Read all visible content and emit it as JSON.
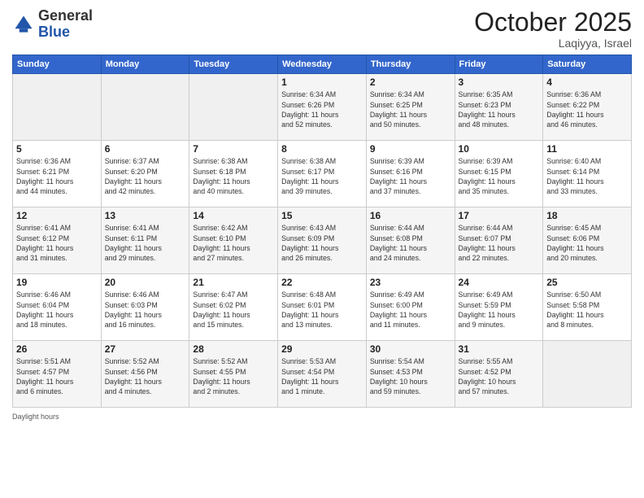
{
  "header": {
    "logo_general": "General",
    "logo_blue": "Blue",
    "month": "October 2025",
    "location": "Laqiyya, Israel"
  },
  "weekdays": [
    "Sunday",
    "Monday",
    "Tuesday",
    "Wednesday",
    "Thursday",
    "Friday",
    "Saturday"
  ],
  "weeks": [
    [
      {
        "day": "",
        "info": ""
      },
      {
        "day": "",
        "info": ""
      },
      {
        "day": "",
        "info": ""
      },
      {
        "day": "1",
        "info": "Sunrise: 6:34 AM\nSunset: 6:26 PM\nDaylight: 11 hours\nand 52 minutes."
      },
      {
        "day": "2",
        "info": "Sunrise: 6:34 AM\nSunset: 6:25 PM\nDaylight: 11 hours\nand 50 minutes."
      },
      {
        "day": "3",
        "info": "Sunrise: 6:35 AM\nSunset: 6:23 PM\nDaylight: 11 hours\nand 48 minutes."
      },
      {
        "day": "4",
        "info": "Sunrise: 6:36 AM\nSunset: 6:22 PM\nDaylight: 11 hours\nand 46 minutes."
      }
    ],
    [
      {
        "day": "5",
        "info": "Sunrise: 6:36 AM\nSunset: 6:21 PM\nDaylight: 11 hours\nand 44 minutes."
      },
      {
        "day": "6",
        "info": "Sunrise: 6:37 AM\nSunset: 6:20 PM\nDaylight: 11 hours\nand 42 minutes."
      },
      {
        "day": "7",
        "info": "Sunrise: 6:38 AM\nSunset: 6:18 PM\nDaylight: 11 hours\nand 40 minutes."
      },
      {
        "day": "8",
        "info": "Sunrise: 6:38 AM\nSunset: 6:17 PM\nDaylight: 11 hours\nand 39 minutes."
      },
      {
        "day": "9",
        "info": "Sunrise: 6:39 AM\nSunset: 6:16 PM\nDaylight: 11 hours\nand 37 minutes."
      },
      {
        "day": "10",
        "info": "Sunrise: 6:39 AM\nSunset: 6:15 PM\nDaylight: 11 hours\nand 35 minutes."
      },
      {
        "day": "11",
        "info": "Sunrise: 6:40 AM\nSunset: 6:14 PM\nDaylight: 11 hours\nand 33 minutes."
      }
    ],
    [
      {
        "day": "12",
        "info": "Sunrise: 6:41 AM\nSunset: 6:12 PM\nDaylight: 11 hours\nand 31 minutes."
      },
      {
        "day": "13",
        "info": "Sunrise: 6:41 AM\nSunset: 6:11 PM\nDaylight: 11 hours\nand 29 minutes."
      },
      {
        "day": "14",
        "info": "Sunrise: 6:42 AM\nSunset: 6:10 PM\nDaylight: 11 hours\nand 27 minutes."
      },
      {
        "day": "15",
        "info": "Sunrise: 6:43 AM\nSunset: 6:09 PM\nDaylight: 11 hours\nand 26 minutes."
      },
      {
        "day": "16",
        "info": "Sunrise: 6:44 AM\nSunset: 6:08 PM\nDaylight: 11 hours\nand 24 minutes."
      },
      {
        "day": "17",
        "info": "Sunrise: 6:44 AM\nSunset: 6:07 PM\nDaylight: 11 hours\nand 22 minutes."
      },
      {
        "day": "18",
        "info": "Sunrise: 6:45 AM\nSunset: 6:06 PM\nDaylight: 11 hours\nand 20 minutes."
      }
    ],
    [
      {
        "day": "19",
        "info": "Sunrise: 6:46 AM\nSunset: 6:04 PM\nDaylight: 11 hours\nand 18 minutes."
      },
      {
        "day": "20",
        "info": "Sunrise: 6:46 AM\nSunset: 6:03 PM\nDaylight: 11 hours\nand 16 minutes."
      },
      {
        "day": "21",
        "info": "Sunrise: 6:47 AM\nSunset: 6:02 PM\nDaylight: 11 hours\nand 15 minutes."
      },
      {
        "day": "22",
        "info": "Sunrise: 6:48 AM\nSunset: 6:01 PM\nDaylight: 11 hours\nand 13 minutes."
      },
      {
        "day": "23",
        "info": "Sunrise: 6:49 AM\nSunset: 6:00 PM\nDaylight: 11 hours\nand 11 minutes."
      },
      {
        "day": "24",
        "info": "Sunrise: 6:49 AM\nSunset: 5:59 PM\nDaylight: 11 hours\nand 9 minutes."
      },
      {
        "day": "25",
        "info": "Sunrise: 6:50 AM\nSunset: 5:58 PM\nDaylight: 11 hours\nand 8 minutes."
      }
    ],
    [
      {
        "day": "26",
        "info": "Sunrise: 5:51 AM\nSunset: 4:57 PM\nDaylight: 11 hours\nand 6 minutes."
      },
      {
        "day": "27",
        "info": "Sunrise: 5:52 AM\nSunset: 4:56 PM\nDaylight: 11 hours\nand 4 minutes."
      },
      {
        "day": "28",
        "info": "Sunrise: 5:52 AM\nSunset: 4:55 PM\nDaylight: 11 hours\nand 2 minutes."
      },
      {
        "day": "29",
        "info": "Sunrise: 5:53 AM\nSunset: 4:54 PM\nDaylight: 11 hours\nand 1 minute."
      },
      {
        "day": "30",
        "info": "Sunrise: 5:54 AM\nSunset: 4:53 PM\nDaylight: 10 hours\nand 59 minutes."
      },
      {
        "day": "31",
        "info": "Sunrise: 5:55 AM\nSunset: 4:52 PM\nDaylight: 10 hours\nand 57 minutes."
      },
      {
        "day": "",
        "info": ""
      }
    ]
  ]
}
